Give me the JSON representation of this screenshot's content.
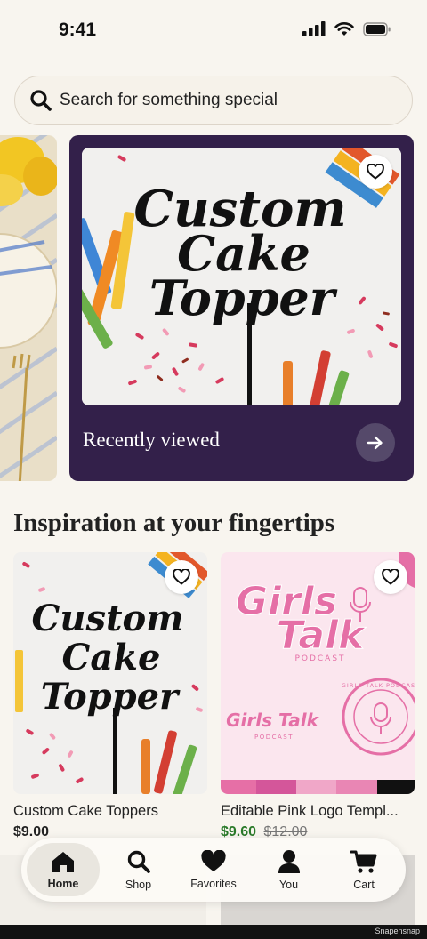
{
  "status_bar": {
    "time": "9:41"
  },
  "search": {
    "placeholder": "Search for something special"
  },
  "hero": {
    "label": "Recently viewed",
    "image_text": [
      "Custom",
      "Cake",
      "Topper"
    ],
    "colors": {
      "card_bg": "#33204a"
    }
  },
  "section": {
    "title": "Inspiration at your fingertips"
  },
  "products": [
    {
      "title": "Custom Cake Toppers",
      "price": "$9.00",
      "image_text": [
        "Custom",
        "Cake",
        "Topper"
      ]
    },
    {
      "title": "Editable Pink Logo Templ...",
      "price": "$9.60",
      "original_price": "$12.00",
      "image_text": {
        "logo_top": "Girls",
        "logo_bottom": "Talk",
        "sub": "PODCAST",
        "small_logo": "Girls Talk",
        "small_sub": "PODCAST",
        "seal": "GIRLS TALK PODCAST"
      }
    }
  ],
  "tabs": [
    {
      "label": "Home",
      "icon": "home-icon",
      "active": true
    },
    {
      "label": "Shop",
      "icon": "search-icon",
      "active": false
    },
    {
      "label": "Favorites",
      "icon": "heart-icon",
      "active": false
    },
    {
      "label": "You",
      "icon": "person-icon",
      "active": false
    },
    {
      "label": "Cart",
      "icon": "cart-icon",
      "active": false
    }
  ],
  "watermark": "Snapensnap",
  "accent_colors": {
    "hero_bg": "#33204a",
    "pink": "#e56fa6"
  }
}
